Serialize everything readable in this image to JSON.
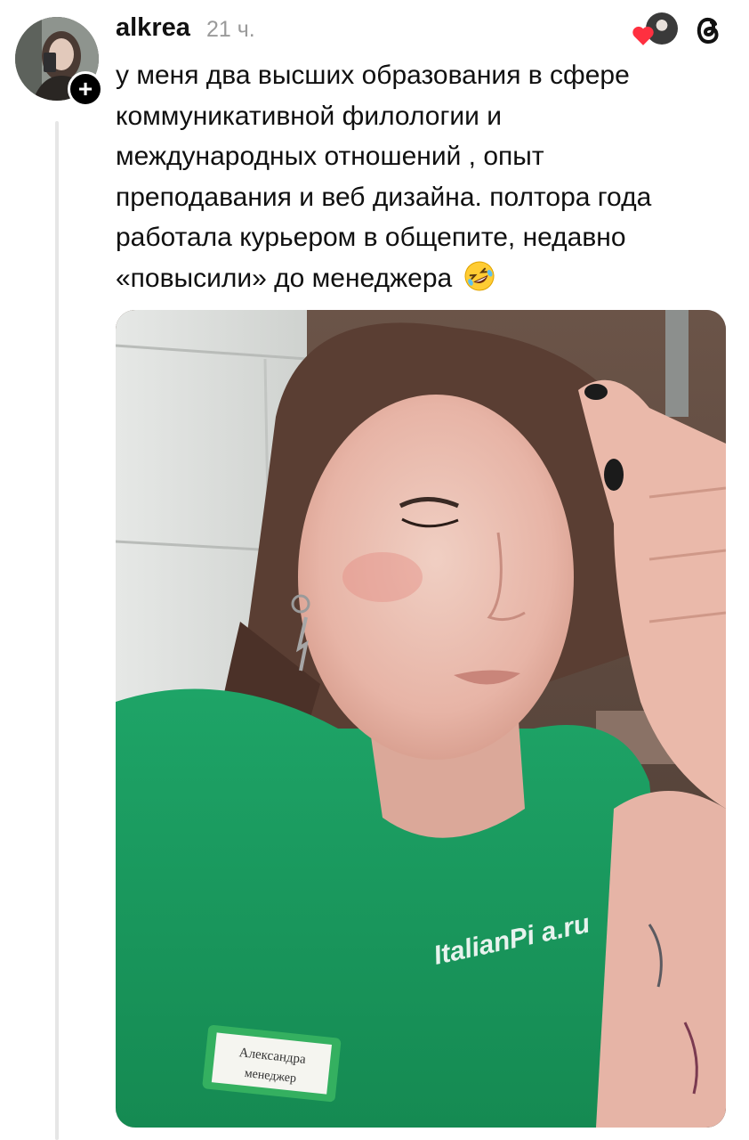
{
  "post": {
    "username": "alkrea",
    "timestamp": "21 ч.",
    "text_lines": [
      "у меня два высших образования в сфере",
      "коммуникативной филологии и",
      "международных отношений , опыт",
      "преподавания и веб дизайна. полтора года",
      "работала курьером в общепите, недавно",
      "«повысили» до менеджера"
    ],
    "emoji": "rolling-on-floor-laughing-emoji",
    "follow_symbol": "+"
  },
  "photo": {
    "shirt_print": "ItalianPi  a.ru",
    "badge_name": "Александра",
    "badge_title": "менеджер"
  },
  "icons": {
    "reaction": "heart-icon",
    "app": "threads-logo-icon"
  },
  "colors": {
    "heart": "#ff3040",
    "shirt": "#1a9a5e",
    "timestamp": "#9a9a9a"
  }
}
